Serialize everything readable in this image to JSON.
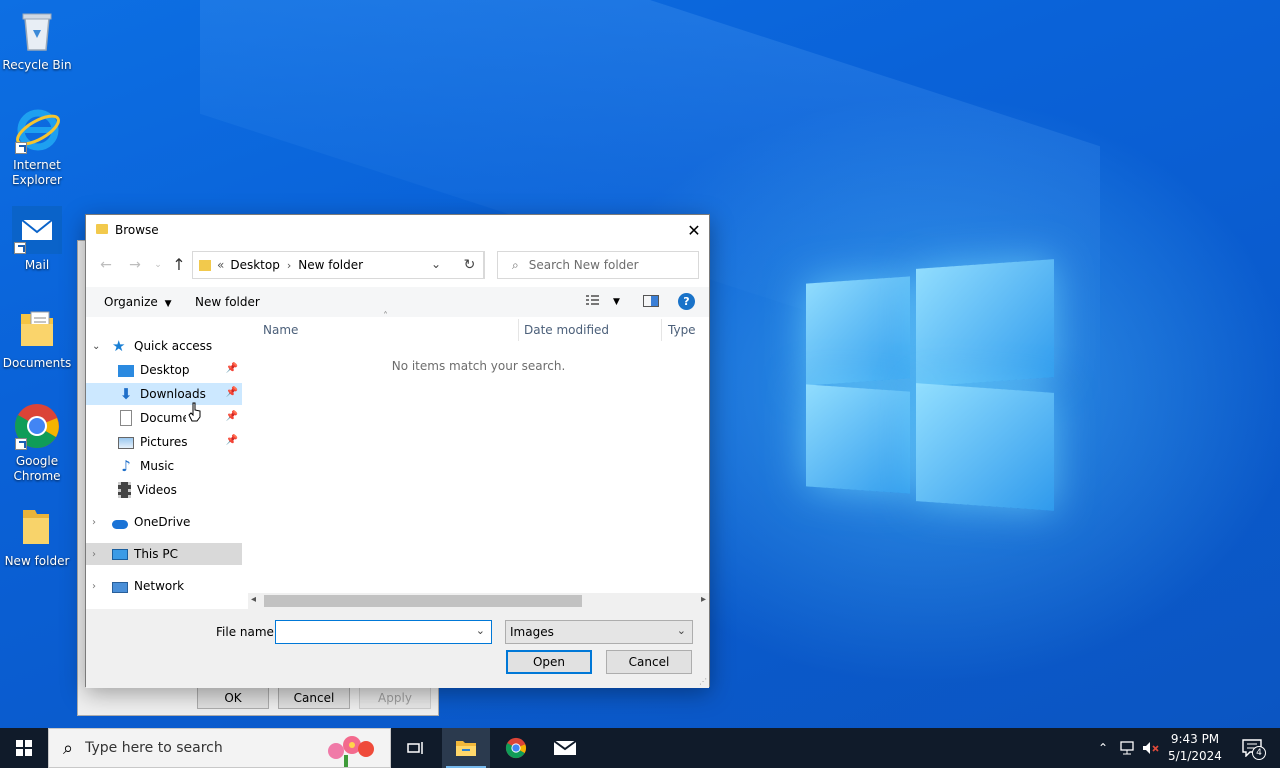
{
  "desktop": {
    "icons": [
      {
        "label": "Recycle Bin"
      },
      {
        "label": "Internet Explorer"
      },
      {
        "label": "Mail"
      },
      {
        "label": "Documents"
      },
      {
        "label": "Google Chrome"
      },
      {
        "label": "New folder"
      }
    ]
  },
  "background_dialog": {
    "ok_label": "OK",
    "cancel_label": "Cancel",
    "apply_label": "Apply"
  },
  "dialog": {
    "title": "Browse",
    "address": {
      "overflow": "«",
      "crumbs": [
        "Desktop",
        "New folder"
      ]
    },
    "search_placeholder": "Search New folder",
    "toolbar": {
      "organize_label": "Organize",
      "new_folder_label": "New folder"
    },
    "nav": {
      "quick_access": "Quick access",
      "items": [
        {
          "label": "Desktop"
        },
        {
          "label": "Downloads"
        },
        {
          "label": "Documents"
        },
        {
          "label": "Pictures"
        },
        {
          "label": "Music"
        },
        {
          "label": "Videos"
        }
      ],
      "onedrive": "OneDrive",
      "this_pc": "This PC",
      "network": "Network"
    },
    "columns": [
      "Name",
      "Date modified",
      "Type"
    ],
    "empty_message": "No items match your search.",
    "file_name_label": "File name:",
    "file_name_value": "",
    "file_type": "Images",
    "open_label": "Open",
    "cancel_label": "Cancel"
  },
  "taskbar": {
    "search_placeholder": "Type here to search",
    "time": "9:43 PM",
    "date": "5/1/2024",
    "notification_count": "4"
  }
}
